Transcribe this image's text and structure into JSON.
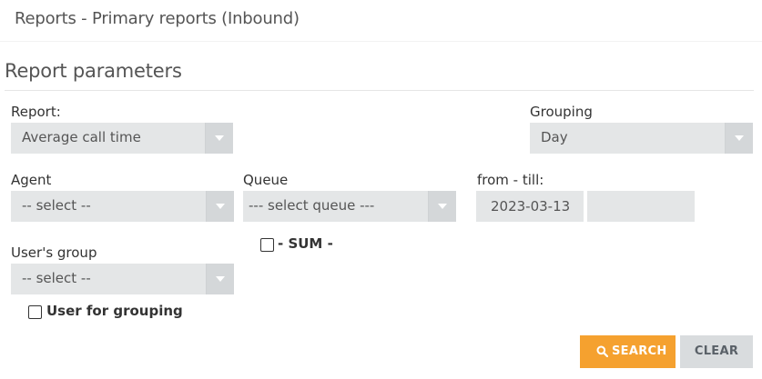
{
  "header": {
    "title": "Reports - Primary reports (Inbound)"
  },
  "section": {
    "title": "Report parameters"
  },
  "form": {
    "report": {
      "label": "Report:",
      "value": "Average call time"
    },
    "grouping": {
      "label": "Grouping",
      "value": "Day"
    },
    "agent": {
      "label": "Agent",
      "value": "-- select --"
    },
    "queue": {
      "label": "Queue",
      "value": "--- select queue ---"
    },
    "date_range": {
      "label": "from - till:",
      "from": "2023-03-13",
      "till": ""
    },
    "sum_checkbox": {
      "label": "- SUM -",
      "checked": false
    },
    "user_group": {
      "label": "User's group",
      "value": "-- select --"
    },
    "user_for_grouping": {
      "label": "User for grouping",
      "checked": false
    }
  },
  "actions": {
    "search_label": "SEARCH",
    "clear_label": "CLEAR",
    "search_icon": "search-icon"
  },
  "colors": {
    "search_button": "#f5a12f",
    "clear_button": "#d9dcde",
    "select_bg": "#e4e6e7"
  }
}
